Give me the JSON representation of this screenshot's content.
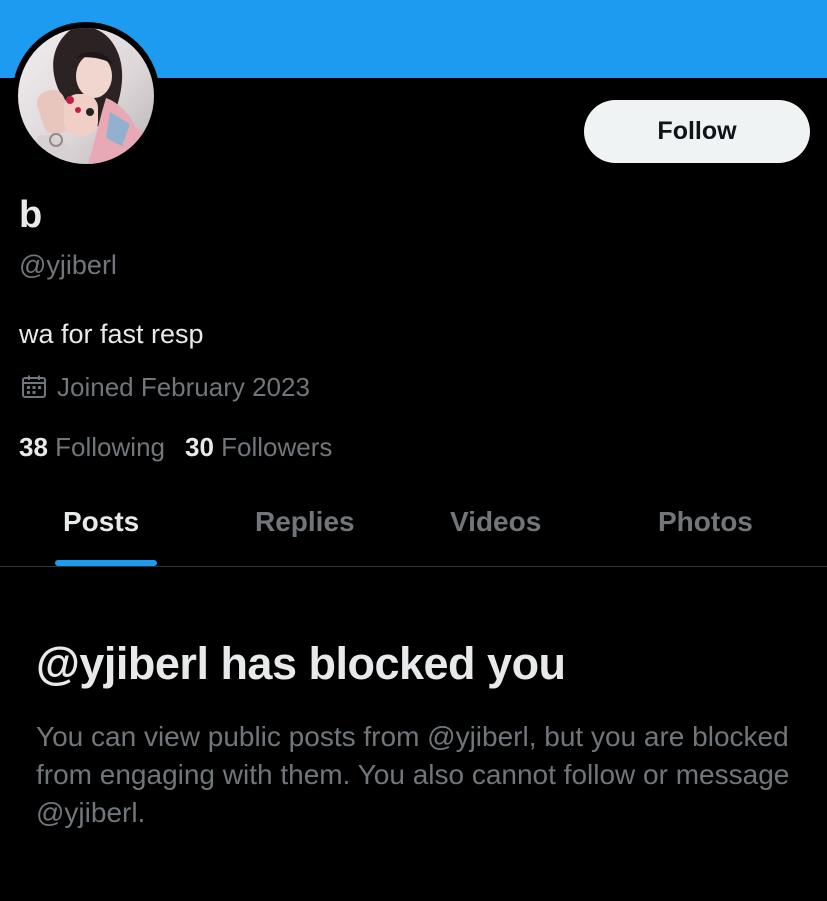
{
  "colors": {
    "banner": "#1d9bf0",
    "accent": "#1d9bf0",
    "background": "#000000",
    "primary_text": "#e7e9ea",
    "secondary_text": "#71767b",
    "button_bg": "#eff3f4"
  },
  "profile": {
    "avatar_icon": "profile-photo",
    "follow_label": "Follow",
    "display_name": "b",
    "handle": "@yjiberl",
    "bio": "wa for fast resp",
    "joined_icon": "calendar-icon",
    "joined_text": "Joined February 2023",
    "following_count": "38",
    "following_label": "Following",
    "followers_count": "30",
    "followers_label": "Followers"
  },
  "tabs": [
    {
      "label": "Posts",
      "active": true
    },
    {
      "label": "Replies",
      "active": false
    },
    {
      "label": "Videos",
      "active": false
    },
    {
      "label": "Photos",
      "active": false
    }
  ],
  "blocked": {
    "title": "@yjiberl has blocked you",
    "description": "You can view public posts from @yjiberl, but you are blocked from engaging with them. You also cannot follow or message @yjiberl."
  }
}
